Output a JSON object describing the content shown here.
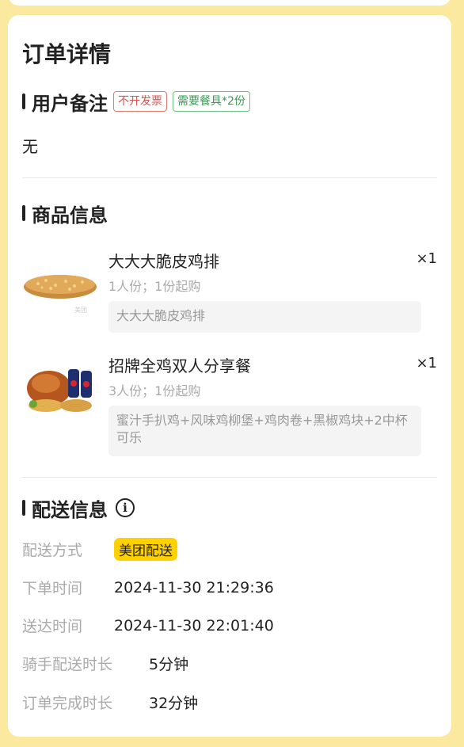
{
  "page_title": "订单详情",
  "remark_section": {
    "title": "用户备注",
    "tags": [
      "不开发票",
      "需要餐具*2份"
    ],
    "note": "无"
  },
  "product_section": {
    "title": "商品信息",
    "items": [
      {
        "name": "大大大脆皮鸡排",
        "qty": "×1",
        "meta": "1人份；1份起购",
        "desc": "大大大脆皮鸡排",
        "image": "crispy-chicken-cutlet"
      },
      {
        "name": "招牌全鸡双人分享餐",
        "qty": "×1",
        "meta": "3人份；1份起购",
        "desc": "蜜汁手扒鸡+风味鸡柳堡+鸡肉卷+黑椒鸡块+2中杯可乐",
        "image": "whole-chicken-meal"
      }
    ]
  },
  "delivery_section": {
    "title": "配送信息",
    "info_icon": "info-icon",
    "rows": [
      {
        "label": "配送方式",
        "value": "美团配送"
      },
      {
        "label": "下单时间",
        "value": "2024-11-30 21:29:36"
      },
      {
        "label": "送达时间",
        "value": "2024-11-30 22:01:40"
      },
      {
        "label": "骑手配送时长",
        "value": "5分钟"
      },
      {
        "label": "订单完成时长",
        "value": "32分钟"
      }
    ]
  },
  "colors": {
    "page_bg": "#fbe9a0",
    "accent_yellow": "#ffd100",
    "tag_red": "#d9534f",
    "tag_green": "#3a9a55"
  }
}
